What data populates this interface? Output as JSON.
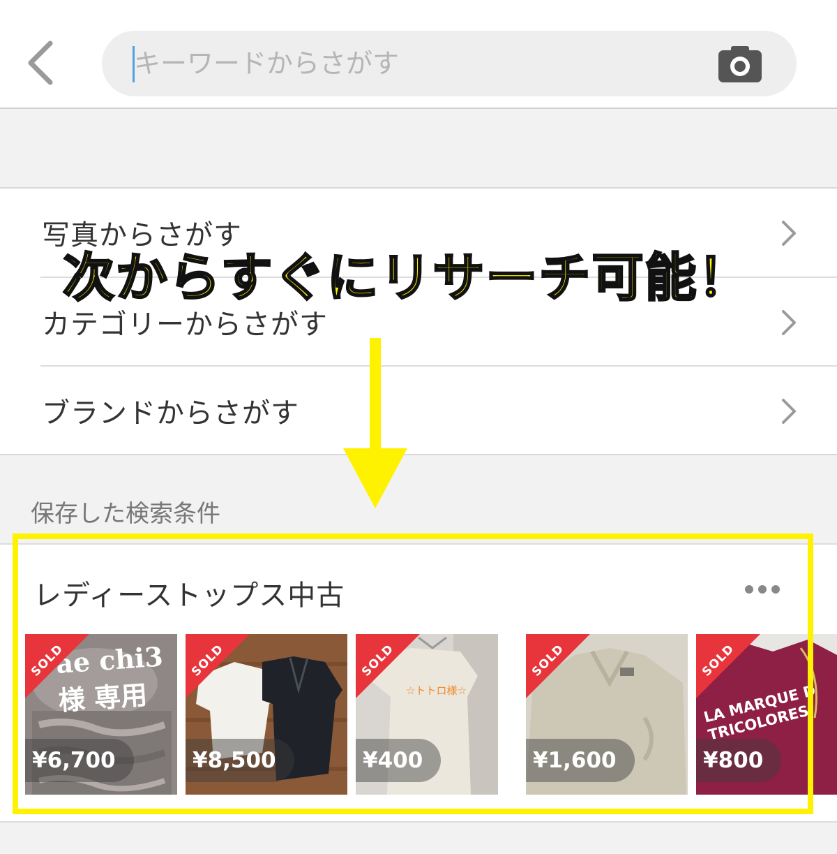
{
  "search": {
    "placeholder": "キーワードからさがす"
  },
  "menu": {
    "items": [
      {
        "label": "写真からさがす"
      },
      {
        "label": "カテゴリーからさがす"
      },
      {
        "label": "ブランドからさがす"
      }
    ]
  },
  "saved": {
    "section_title": "保存した検索条件",
    "card_title": "レディーストップス中古",
    "sold_label": "SOLD",
    "items": [
      {
        "price": "¥6,700",
        "photo_text": "ae chi3 様 専用"
      },
      {
        "price": "¥8,500"
      },
      {
        "price": "¥400",
        "photo_text": "☆トトロ様☆"
      },
      {
        "price": "¥1,600"
      },
      {
        "price": "¥800",
        "photo_text": "LA MARQUE D TRICOLORES"
      }
    ]
  },
  "annotation": {
    "text": "次からすぐにリサーチ可能！"
  },
  "colors": {
    "accent_yellow": "#fff200",
    "sold_red": "#e8353b"
  },
  "icons": {
    "back": "chevron-left-icon",
    "camera": "camera-icon",
    "chevron": "chevron-right-icon",
    "more": "more-dots-icon"
  }
}
